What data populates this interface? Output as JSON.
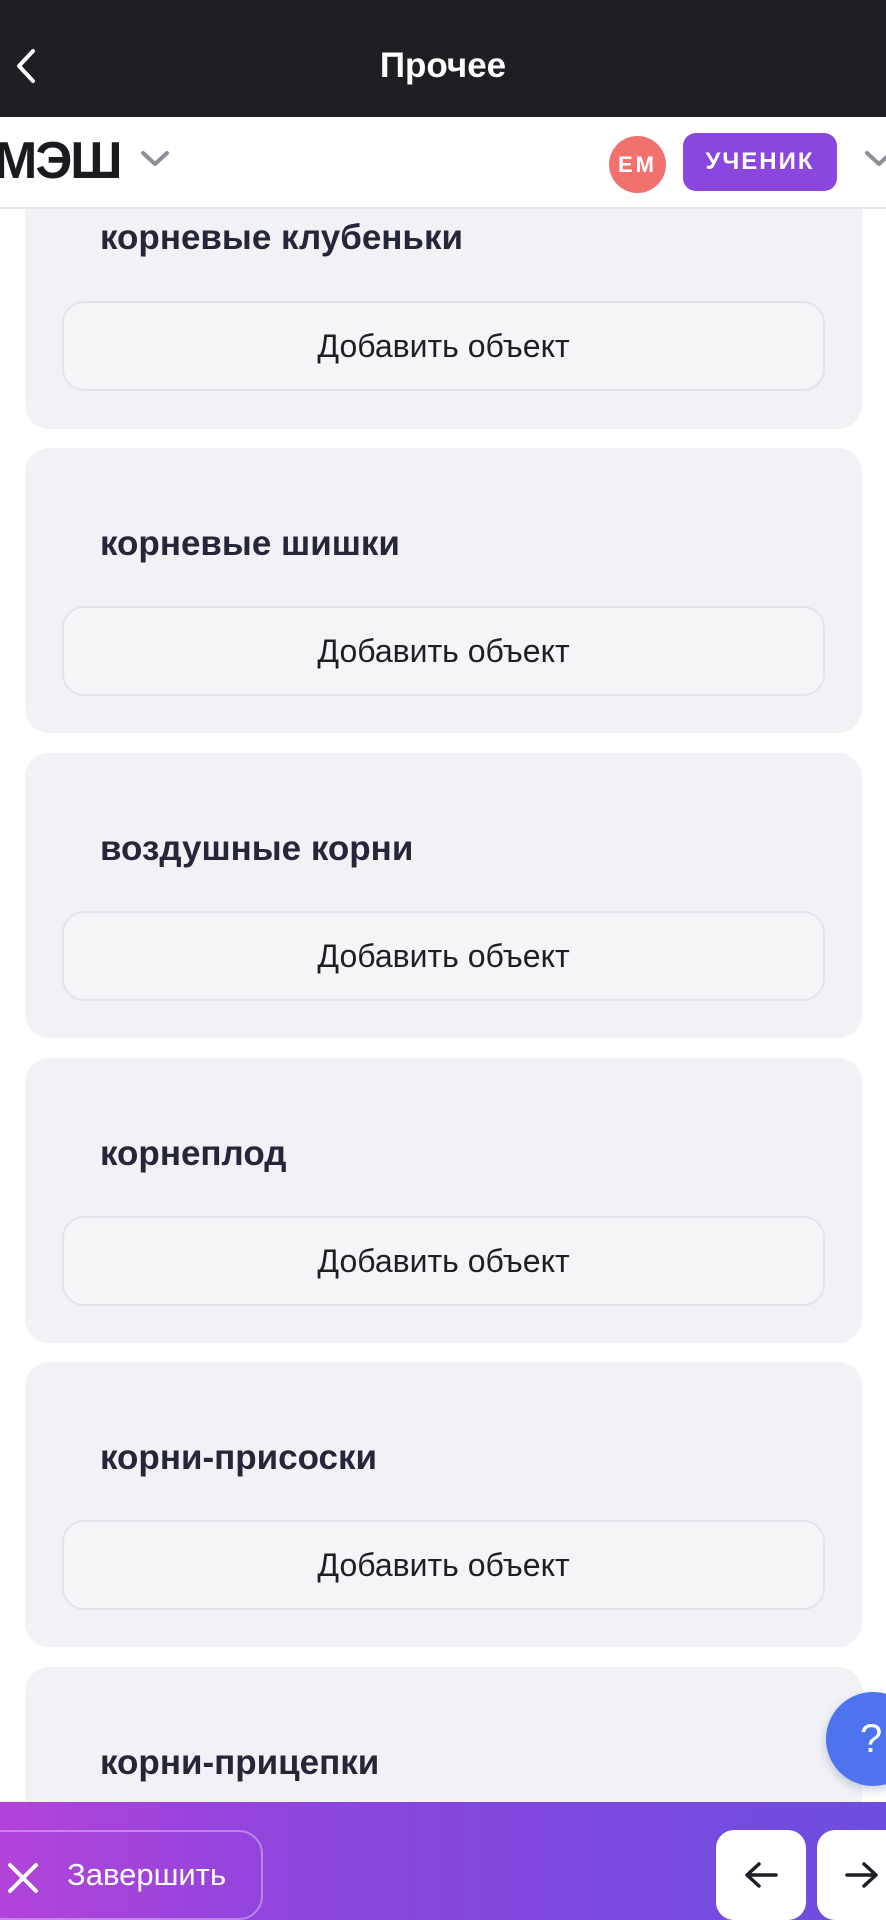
{
  "topbar": {
    "title": "Прочее",
    "back_icon": "chevron-left-icon"
  },
  "header": {
    "logo": "МЭШ",
    "avatar_initials": "ЕМ",
    "role": "УЧЕНИК"
  },
  "cards": [
    {
      "title": "корневые клубеньки",
      "button": "Добавить объект"
    },
    {
      "title": "корневые шишки",
      "button": "Добавить объект"
    },
    {
      "title": "воздушные корни",
      "button": "Добавить объект"
    },
    {
      "title": "корнеплод",
      "button": "Добавить объект"
    },
    {
      "title": "корни-присоски",
      "button": "Добавить объект"
    },
    {
      "title": "корни-прицепки"
    }
  ],
  "help": {
    "label": "?"
  },
  "bottom": {
    "finish_label": "Завершить",
    "prev_icon": "arrow-left-icon",
    "next_icon": "arrow-right-icon"
  },
  "colors": {
    "topbar": "#1e1e23",
    "card": "#f2f2f6",
    "role_badge": "#8a46df",
    "avatar": "#f1716f",
    "help": "#4d74ee",
    "bottom_gradient_start": "#b243d9",
    "bottom_gradient_end": "#6c4ede"
  }
}
